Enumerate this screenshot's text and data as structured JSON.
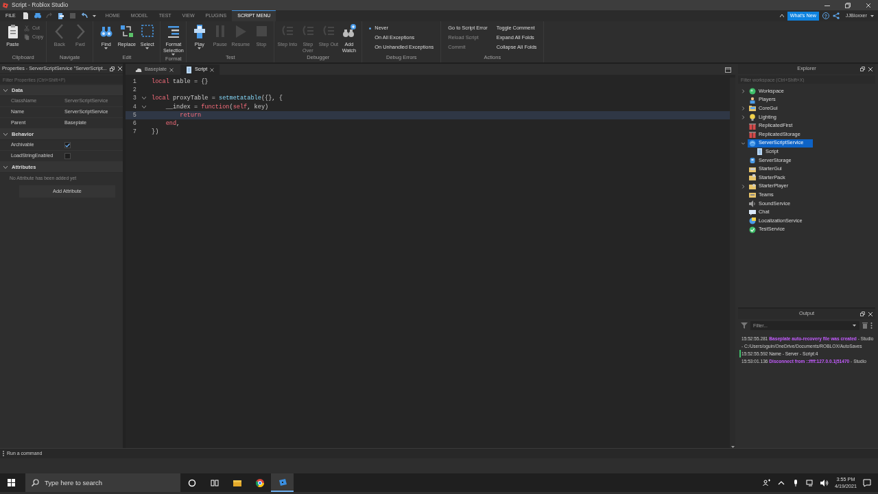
{
  "window": {
    "title": "Script - Roblox Studio"
  },
  "menu": {
    "file": "FILE",
    "tabs": [
      {
        "label": "HOME",
        "selected": false
      },
      {
        "label": "MODEL",
        "selected": false
      },
      {
        "label": "TEST",
        "selected": false
      },
      {
        "label": "VIEW",
        "selected": false
      },
      {
        "label": "PLUGINS",
        "selected": false
      },
      {
        "label": "SCRIPT MENU",
        "selected": true
      }
    ],
    "whats_new": "What's New",
    "help": "?",
    "user": "JJBloxxer"
  },
  "ribbon": {
    "groups": [
      {
        "label": "Clipboard",
        "tools": [
          {
            "label": "Paste",
            "kind": "large",
            "disabled": false
          },
          {
            "label": "Cut",
            "kind": "small",
            "disabled": true
          },
          {
            "label": "Copy",
            "kind": "small",
            "disabled": true
          }
        ]
      },
      {
        "label": "Navigate",
        "tools": [
          {
            "label": "Back",
            "kind": "large",
            "disabled": true
          },
          {
            "label": "Fwd",
            "kind": "large",
            "disabled": true
          }
        ]
      },
      {
        "label": "Edit",
        "tools": [
          {
            "label": "Find",
            "kind": "large",
            "disabled": false,
            "dropdown": true
          },
          {
            "label": "Replace",
            "kind": "large",
            "disabled": false
          },
          {
            "label": "Select",
            "kind": "large",
            "disabled": false,
            "dropdown": true
          }
        ]
      },
      {
        "label": "Format",
        "tools": [
          {
            "label": "Format Selection",
            "kind": "large",
            "disabled": false,
            "dropdown": true
          }
        ]
      },
      {
        "label": "Test",
        "tools": [
          {
            "label": "Play",
            "kind": "large",
            "disabled": false,
            "dropdown": true
          },
          {
            "label": "Pause",
            "kind": "large",
            "disabled": true
          },
          {
            "label": "Resume",
            "kind": "large",
            "disabled": true
          },
          {
            "label": "Stop",
            "kind": "large",
            "disabled": true
          }
        ]
      },
      {
        "label": "Debugger",
        "tools": [
          {
            "label": "Step Into",
            "kind": "large",
            "disabled": true
          },
          {
            "label": "Step Over",
            "kind": "large",
            "disabled": true
          },
          {
            "label": "Step Out",
            "kind": "large",
            "disabled": true
          },
          {
            "label": "Add Watch",
            "kind": "large",
            "disabled": false
          }
        ]
      },
      {
        "label": "Debug Errors",
        "tools": [
          {
            "label": "Never",
            "kind": "radio",
            "selected": true
          },
          {
            "label": "On All Exceptions",
            "kind": "radio",
            "selected": false
          },
          {
            "label": "On Unhandled Exceptions",
            "kind": "radio",
            "selected": false
          }
        ]
      },
      {
        "label": "Actions",
        "tools": [
          {
            "label": "Go to Script Error",
            "kind": "text",
            "disabled": false
          },
          {
            "label": "Reload Script",
            "kind": "text",
            "disabled": true
          },
          {
            "label": "Commit",
            "kind": "text",
            "disabled": true
          },
          {
            "label": "Toggle Comment",
            "kind": "text",
            "disabled": false
          },
          {
            "label": "Expand All Folds",
            "kind": "text",
            "disabled": false
          },
          {
            "label": "Collapse All Folds",
            "kind": "text",
            "disabled": false
          }
        ]
      }
    ]
  },
  "properties": {
    "title": "Properties - ServerScriptService \"ServerScript...",
    "filter_placeholder": "Filter Properties (Ctrl+Shift+P)",
    "sections": [
      {
        "title": "Data",
        "expanded": true,
        "rows": [
          {
            "name": "ClassName",
            "value": "ServerScriptService",
            "kind": "text",
            "disabled": true
          },
          {
            "name": "Name",
            "value": "ServerScriptService",
            "kind": "text",
            "disabled": false
          },
          {
            "name": "Parent",
            "value": "Baseplate",
            "kind": "text",
            "disabled": false
          }
        ]
      },
      {
        "title": "Behavior",
        "expanded": true,
        "rows": [
          {
            "name": "Archivable",
            "kind": "checkbox",
            "checked": true,
            "disabled": false
          },
          {
            "name": "LoadStringEnabled",
            "kind": "checkbox",
            "checked": false,
            "disabled": false
          }
        ]
      },
      {
        "title": "Attributes",
        "expanded": true,
        "note": "No Attribute has been added yet",
        "button": "Add Attribute"
      }
    ]
  },
  "editor": {
    "tabs": [
      {
        "label": "Baseplate",
        "selected": false
      },
      {
        "label": "Script",
        "selected": true
      }
    ],
    "lines": [
      {
        "number": "1",
        "foldable": false,
        "current": false,
        "tokens": [
          {
            "t": "local",
            "kind": "keyword"
          },
          {
            "t": " table = {}",
            "kind": "plain"
          }
        ]
      },
      {
        "number": "2",
        "foldable": false,
        "current": false
      },
      {
        "number": "3",
        "foldable": true,
        "current": false,
        "tokens": [
          {
            "t": "local",
            "kind": "keyword"
          },
          {
            "t": " proxyTable = ",
            "kind": "plain"
          },
          {
            "t": "setmetatable",
            "kind": "builtin"
          },
          {
            "t": "({}, {",
            "kind": "plain"
          }
        ]
      },
      {
        "number": "4",
        "foldable": true,
        "current": false,
        "tokens": [
          {
            "t": "    __index = ",
            "kind": "plain"
          },
          {
            "t": "function",
            "kind": "keyword"
          },
          {
            "t": "(",
            "kind": "plain"
          },
          {
            "t": "self",
            "kind": "keyword"
          },
          {
            "t": ", key)",
            "kind": "plain"
          }
        ]
      },
      {
        "number": "5",
        "foldable": false,
        "current": true,
        "tokens": [
          {
            "t": "        return",
            "kind": "keyword"
          }
        ]
      },
      {
        "number": "6",
        "foldable": false,
        "current": false,
        "tokens": [
          {
            "t": "    end",
            "kind": "keyword"
          },
          {
            "t": ",",
            "kind": "plain"
          }
        ]
      },
      {
        "number": "7",
        "foldable": false,
        "current": false,
        "tokens": [
          {
            "t": "})",
            "kind": "plain"
          }
        ]
      }
    ]
  },
  "explorer": {
    "title": "Explorer",
    "filter_placeholder": "Filter workspace (Ctrl+Shift+X)",
    "items": [
      {
        "label": "Workspace",
        "expanded": false,
        "selected": false
      },
      {
        "label": "Players",
        "selected": false
      },
      {
        "label": "CoreGui",
        "expanded": false,
        "selected": false
      },
      {
        "label": "Lighting",
        "expanded": false,
        "selected": false
      },
      {
        "label": "ReplicatedFirst",
        "selected": false
      },
      {
        "label": "ReplicatedStorage",
        "selected": false
      },
      {
        "label": "ServerScriptService",
        "expanded": true,
        "selected": true,
        "children": [
          {
            "label": "Script",
            "selected": false
          }
        ]
      },
      {
        "label": "ServerStorage",
        "selected": false
      },
      {
        "label": "StarterGui",
        "selected": false
      },
      {
        "label": "StarterPack",
        "selected": false
      },
      {
        "label": "StarterPlayer",
        "expanded": false,
        "selected": false
      },
      {
        "label": "Teams",
        "selected": false
      },
      {
        "label": "SoundService",
        "selected": false
      },
      {
        "label": "Chat",
        "selected": false
      },
      {
        "label": "LocalizationService",
        "selected": false
      },
      {
        "label": "TestService",
        "selected": false
      }
    ]
  },
  "output": {
    "title": "Output",
    "filter_placeholder": "Filter...",
    "messages": [
      {
        "time": "15:52:55.281",
        "text": "Baseplate auto-recovery file was created",
        "suffix": " - Studio - C:/Users/oguin/OneDrive/Documents/ROBLOX/AutoSaves",
        "kind": "info",
        "marked": false
      },
      {
        "time": "15:52:55.592",
        "text": "Name - Server - Script:4",
        "kind": "print",
        "marked": true
      },
      {
        "time": "15:53:01.136",
        "text": "Disconnect from ::ffff:127.0.0.1|51470",
        "suffix": " - Studio",
        "kind": "info",
        "marked": false
      }
    ]
  },
  "command_bar": {
    "placeholder": "Run a command"
  },
  "taskbar": {
    "search_placeholder": "Type here to search",
    "apps": [
      {
        "selected": false
      },
      {
        "selected": false
      },
      {
        "selected": false
      },
      {
        "selected": false
      },
      {
        "selected": true
      }
    ],
    "time": "3:55 PM",
    "date": "4/19/2021"
  }
}
